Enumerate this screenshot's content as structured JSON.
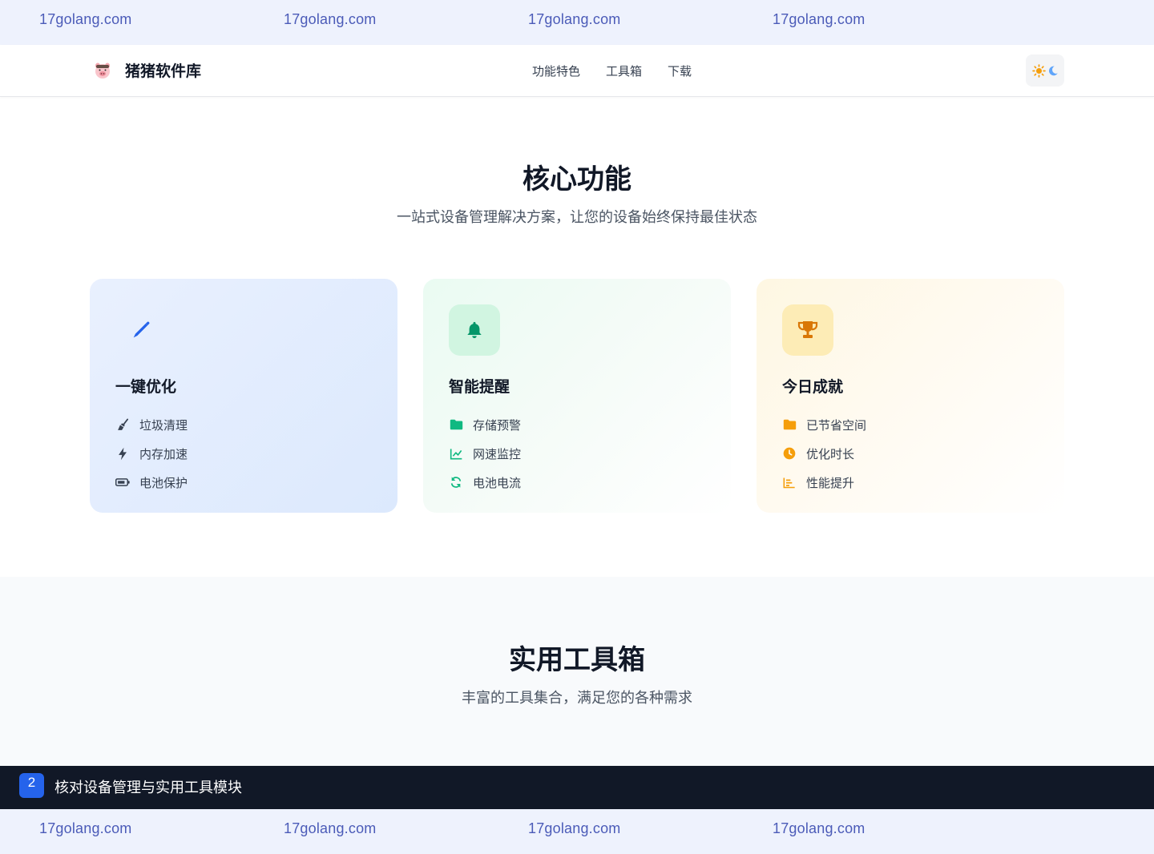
{
  "watermark": {
    "text": [
      "17golang.com",
      "17golang.com",
      "17golang.com",
      "17golang.com"
    ]
  },
  "navbar": {
    "brand_name": "猪猪软件库",
    "links": [
      "功能特色",
      "工具箱",
      "下载"
    ],
    "theme_toggle_icons": [
      "sun-icon",
      "moon-icon"
    ]
  },
  "core": {
    "title": "核心功能",
    "subtitle": "一站式设备管理解决方案，让您的设备始终保持最佳状态",
    "cards": [
      {
        "title": "一键优化",
        "icon": "brush-icon",
        "accent": "#2563eb",
        "items": [
          {
            "label": "垃圾清理",
            "icon": "broom-icon"
          },
          {
            "label": "内存加速",
            "icon": "bolt-icon"
          },
          {
            "label": "电池保护",
            "icon": "battery-icon"
          }
        ]
      },
      {
        "title": "智能提醒",
        "icon": "bell-icon",
        "accent": "#10b981",
        "items": [
          {
            "label": "存储预警",
            "icon": "folder-icon"
          },
          {
            "label": "网速监控",
            "icon": "line-chart-icon"
          },
          {
            "label": "电池电流",
            "icon": "sync-icon"
          }
        ]
      },
      {
        "title": "今日成就",
        "icon": "trophy-icon",
        "accent": "#f59e0b",
        "items": [
          {
            "label": "已节省空间",
            "icon": "folder-icon"
          },
          {
            "label": "优化时长",
            "icon": "clock-icon"
          },
          {
            "label": "性能提升",
            "icon": "bar-chart-icon"
          }
        ]
      }
    ]
  },
  "tools": {
    "title": "实用工具箱",
    "subtitle": "丰富的工具集合，满足您的各种需求"
  },
  "step": {
    "number": "2",
    "text": "核对设备管理与实用工具模块"
  }
}
